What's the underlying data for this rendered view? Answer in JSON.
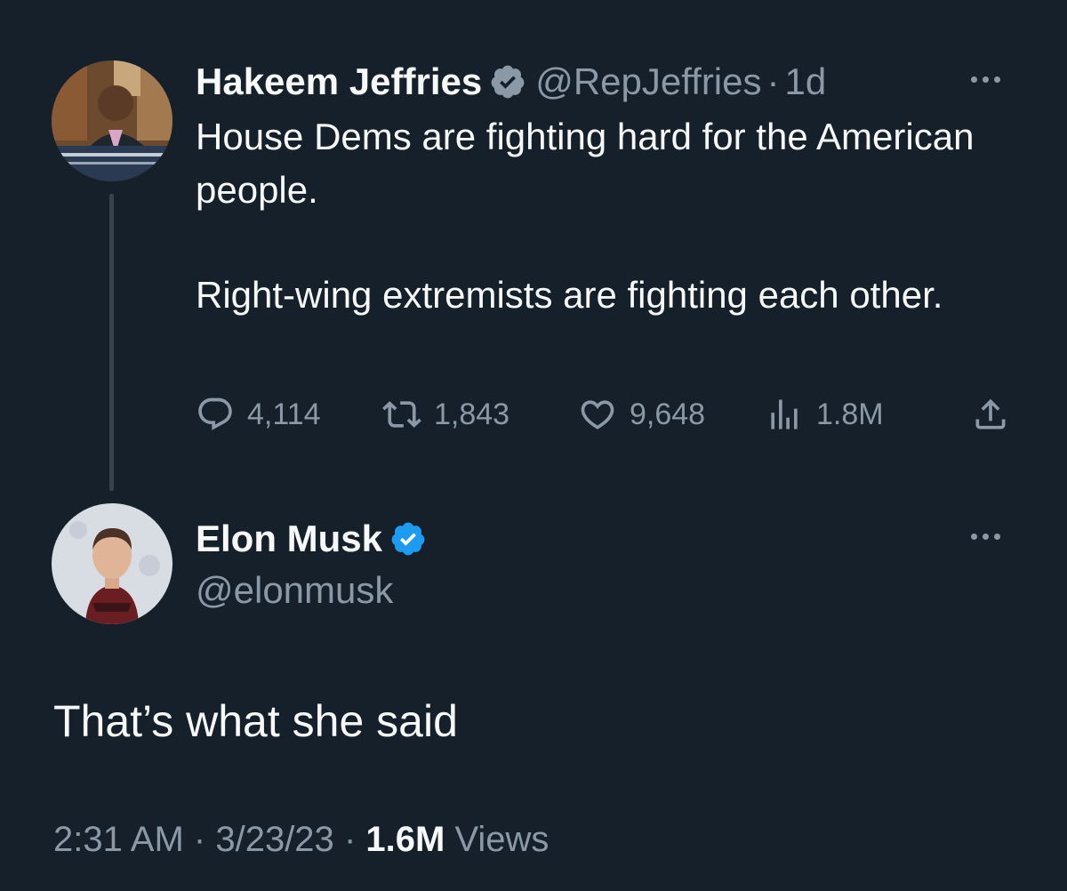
{
  "original_tweet": {
    "author_name": "Hakeem Jeffries",
    "author_handle": "@RepJeffries",
    "separator": "·",
    "age": "1d",
    "text_paragraphs": [
      "House Dems are fighting hard for the American people.",
      "Right-wing extremists are fighting each other."
    ],
    "verified_badge_color": "#8b98a5",
    "stats": {
      "replies": "4,114",
      "retweets": "1,843",
      "likes": "9,648",
      "views": "1.8M"
    },
    "icons": {
      "reply": "reply-icon",
      "retweet": "retweet-icon",
      "like": "heart-icon",
      "views": "views-chart-icon",
      "share": "share-icon",
      "more": "more-options-icon"
    }
  },
  "reply_tweet": {
    "author_name": "Elon Musk",
    "author_handle": "@elonmusk",
    "verified_badge_color": "#1d9bf0",
    "text": "That’s what she said",
    "timestamp": {
      "time": "2:31 AM",
      "separator": "·",
      "date": "3/23/23",
      "views_count": "1.6M",
      "views_label": "Views"
    }
  },
  "colors": {
    "background": "#15202b",
    "primary_text": "#f7f9f9",
    "secondary_text": "#8b98a5",
    "thread_line": "#38444d"
  }
}
